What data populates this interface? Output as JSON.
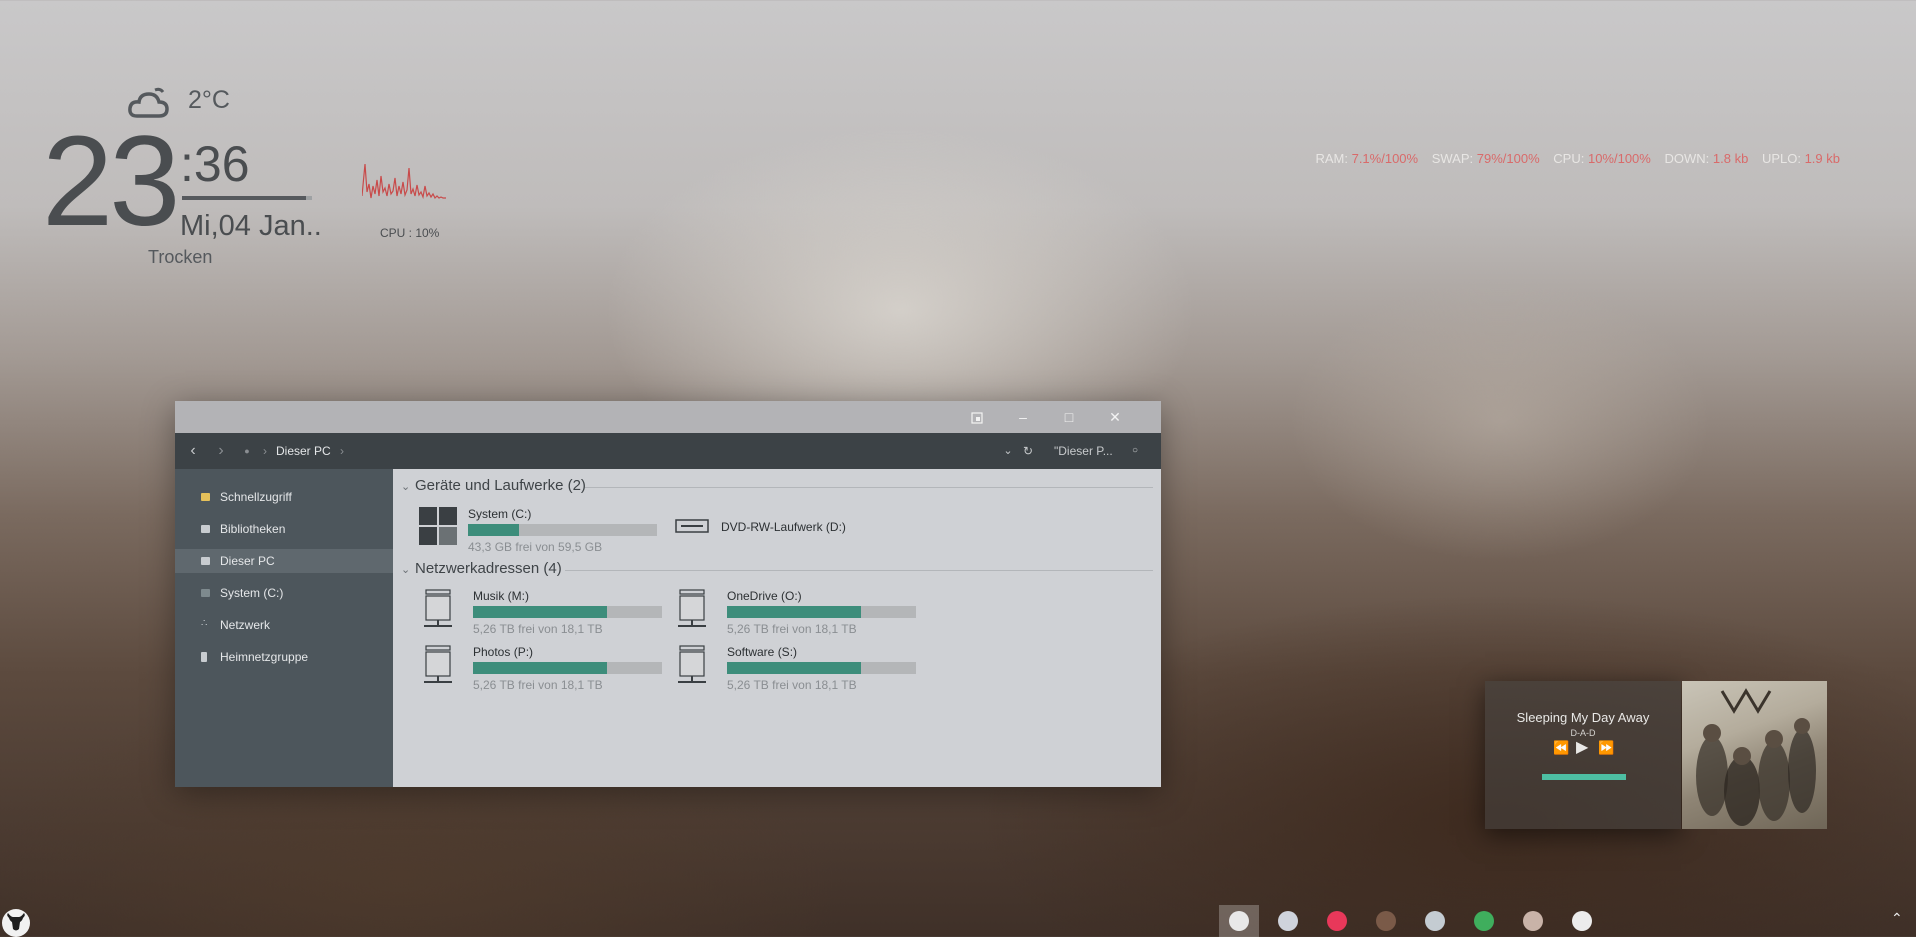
{
  "clock_widget": {
    "temperature": "2°C",
    "hour": "23",
    "minute": ":36",
    "date": "Mi,04 Jan..",
    "condition": "Trocken",
    "weather_icon": "cloud-moon-icon"
  },
  "cpu_widget": {
    "label": "CPU : 10%",
    "color": "#c84a4a"
  },
  "sysstats": {
    "ram_label": "RAM:",
    "ram_value": "7.1%/100%",
    "swap_label": "SWAP:",
    "swap_value": "79%/100%",
    "cpu_label": "CPU:",
    "cpu_value": "10%/100%",
    "down_label": "DOWN:",
    "down_value": "1.8 kb",
    "up_label": "UPLO:",
    "up_value": "1.9 kb"
  },
  "explorer": {
    "breadcrumb": "Dieser PC",
    "search_placeholder": "\"Dieser P...",
    "sidebar": [
      {
        "label": "Schnellzugriff",
        "icon": "star-icon"
      },
      {
        "label": "Bibliotheken",
        "icon": "library-icon"
      },
      {
        "label": "Dieser PC",
        "icon": "computer-icon"
      },
      {
        "label": "System (C:)",
        "icon": "drive-icon"
      },
      {
        "label": "Netzwerk",
        "icon": "network-icon"
      },
      {
        "label": "Heimnetzgruppe",
        "icon": "homegroup-icon"
      }
    ],
    "groups": {
      "devices": "Geräte und Laufwerke (2)",
      "network": "Netzwerkadressen (4)"
    },
    "drives": {
      "system": {
        "name": "System (C:)",
        "info": "43,3 GB frei von 59,5 GB",
        "used": 0.27
      },
      "dvd": {
        "name": "DVD-RW-Laufwerk (D:)"
      },
      "musik": {
        "name": "Musik (M:)",
        "info": "5,26 TB frei von 18,1 TB",
        "used": 0.71
      },
      "onedrive": {
        "name": "OneDrive (O:)",
        "info": "5,26 TB frei von 18,1 TB",
        "used": 0.71
      },
      "photos": {
        "name": "Photos (P:)",
        "info": "5,26 TB frei von 18,1 TB",
        "used": 0.71
      },
      "software": {
        "name": "Software (S:)",
        "info": "5,26 TB frei von 18,1 TB",
        "used": 0.71
      }
    },
    "accent": "#3d8d7b"
  },
  "music": {
    "title": "Sleeping My Day Away",
    "artist": "D-A-D",
    "progress": 1.0,
    "accent": "#4dbfa3"
  },
  "taskbar": {
    "apps": [
      {
        "name": "app-icon-1",
        "color": "#e8e8e8"
      },
      {
        "name": "app-icon-2",
        "color": "#cfd3dc"
      },
      {
        "name": "itunes-icon",
        "color": "#e8385a"
      },
      {
        "name": "avatar-icon",
        "color": "#7a5a48"
      },
      {
        "name": "bird-icon",
        "color": "#c4ccd2"
      },
      {
        "name": "alien-icon",
        "color": "#3fae5d"
      },
      {
        "name": "character-icon",
        "color": "#c9b3a8"
      },
      {
        "name": "stormtrooper-icon",
        "color": "#ececec"
      }
    ]
  }
}
